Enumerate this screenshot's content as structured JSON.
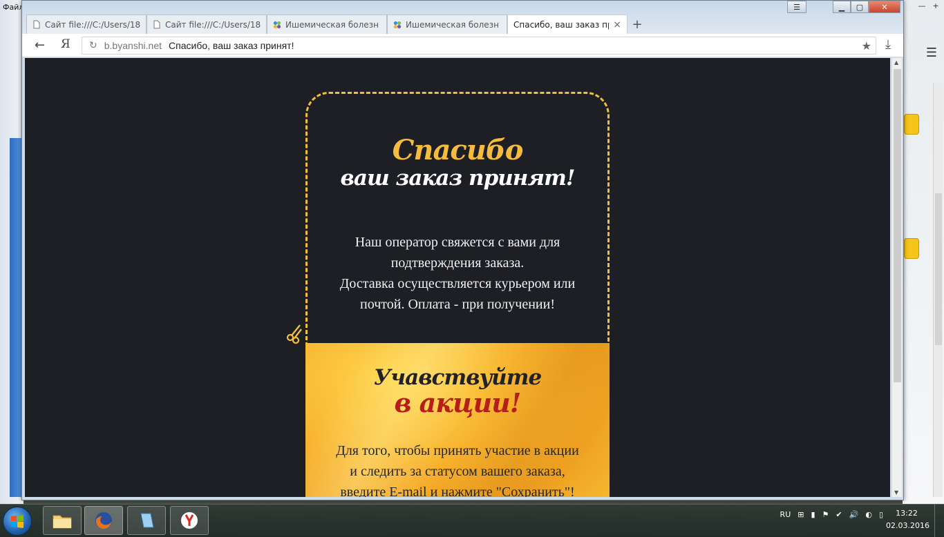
{
  "background": {
    "menu_fragment": "Файл"
  },
  "browser": {
    "tabs": [
      {
        "label": "Сайт file:///C:/Users/18",
        "icon": "page-icon",
        "active": false
      },
      {
        "label": "Сайт file:///C:/Users/18",
        "icon": "page-icon",
        "active": false
      },
      {
        "label": "Ишемическая болезн",
        "icon": "site-favicon-icon",
        "active": false
      },
      {
        "label": "Ишемическая болезн",
        "icon": "site-favicon-icon",
        "active": false
      },
      {
        "label": "Спасибо, ваш заказ пр",
        "icon": "",
        "active": true
      }
    ],
    "close_tab_glyph": "×",
    "new_tab_glyph": "+",
    "back_glyph": "←",
    "yandex_glyph": "Я",
    "reload_glyph": "↻",
    "address_domain": "b.byanshi.net",
    "address_title": "Спасибо, ваш заказ принят!",
    "star_glyph": "★",
    "download_glyph": "⤓"
  },
  "page": {
    "heading_thanks": "Спасибо",
    "heading_accepted": "ваш заказ принят!",
    "message_lines": [
      "Наш оператор свяжется с вами для",
      "подтверждения заказа.",
      "Доставка осуществляется курьером или",
      "почтой. Оплата - при получении!"
    ],
    "promo_heading_1": "Учавствуйте",
    "promo_heading_2": "в акции!",
    "promo_lines": [
      "Для того, чтобы принять участие в акции",
      "и следить за статусом вашего заказа,",
      "введите E-mail и нажмите \"Сохранить\"!"
    ],
    "colors": {
      "page_bg": "#1d1f24",
      "accent_yellow": "#f4bb3c",
      "promo_red": "#b61f17"
    }
  },
  "taskbar": {
    "apps": [
      "folder-icon",
      "firefox-icon",
      "notepad-icon",
      "yandex-browser-icon"
    ],
    "language": "RU",
    "time": "13:22",
    "date": "02.03.2016"
  }
}
